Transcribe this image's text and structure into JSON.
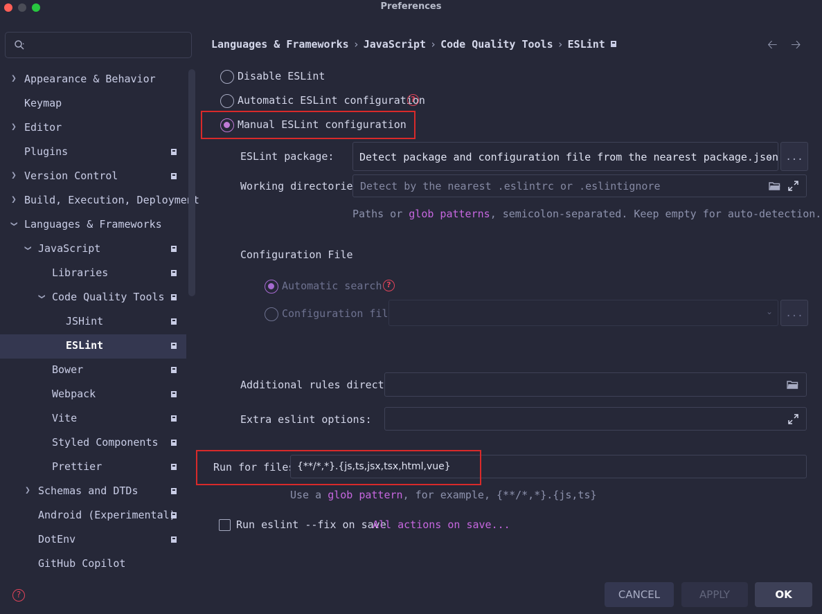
{
  "window": {
    "title": "Preferences"
  },
  "search": {
    "placeholder": "",
    "value": ""
  },
  "sidebar": {
    "items": [
      {
        "label": "Appearance & Behavior"
      },
      {
        "label": "Keymap"
      },
      {
        "label": "Editor"
      },
      {
        "label": "Plugins"
      },
      {
        "label": "Version Control"
      },
      {
        "label": "Build, Execution, Deployment"
      },
      {
        "label": "Languages & Frameworks"
      },
      {
        "label": "JavaScript"
      },
      {
        "label": "Libraries"
      },
      {
        "label": "Code Quality Tools"
      },
      {
        "label": "JSHint"
      },
      {
        "label": "ESLint"
      },
      {
        "label": "Bower"
      },
      {
        "label": "Webpack"
      },
      {
        "label": "Vite"
      },
      {
        "label": "Styled Components"
      },
      {
        "label": "Prettier"
      },
      {
        "label": "Schemas and DTDs"
      },
      {
        "label": "Android (Experimental)"
      },
      {
        "label": "DotEnv"
      },
      {
        "label": "GitHub Copilot"
      }
    ],
    "selected": "ESLint"
  },
  "breadcrumb": [
    "Languages & Frameworks",
    "JavaScript",
    "Code Quality Tools",
    "ESLint"
  ],
  "mode": {
    "disable_label": "Disable ESLint",
    "automatic_label": "Automatic ESLint configuration",
    "manual_label": "Manual ESLint configuration",
    "selected": "manual"
  },
  "eslint_package": {
    "label": "ESLint package:",
    "value": "Detect package and configuration file from the nearest package.json",
    "more": "..."
  },
  "working_dirs": {
    "label": "Working directories:",
    "placeholder": "Detect by the nearest .eslintrc or .eslintignore",
    "hint_pre": "Paths or ",
    "hint_link": "glob patterns",
    "hint_post": ", semicolon-separated. Keep empty for auto-detection."
  },
  "config_file": {
    "title": "Configuration File",
    "automatic_label": "Automatic search",
    "file_label": "Configuration file:",
    "selected": "automatic",
    "more": "..."
  },
  "additional_rules": {
    "label": "Additional rules directory:",
    "value": ""
  },
  "extra_options": {
    "label": "Extra eslint options:",
    "value": ""
  },
  "run_for_files": {
    "label": "Run for files:",
    "value": "{**/*,*}.{js,ts,jsx,tsx,html,vue}",
    "hint_pre": "Use a ",
    "hint_link": "glob pattern",
    "hint_post": ", for example, {**/*,*}.{js,ts}"
  },
  "fix_on_save": {
    "label": "Run eslint --fix on save",
    "checked": false,
    "link": "All actions on save..."
  },
  "buttons": {
    "cancel": "CANCEL",
    "apply": "APPLY",
    "ok": "OK"
  },
  "colors": {
    "accent": "#c767e0",
    "highlight_box": "#d92a2a",
    "help": "#e0445a",
    "background": "#262838"
  }
}
